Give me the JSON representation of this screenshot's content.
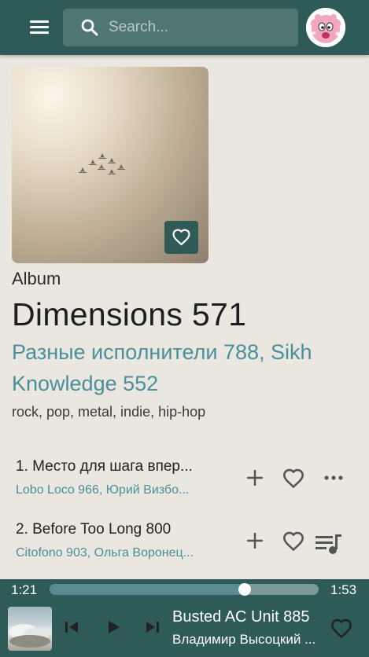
{
  "search": {
    "placeholder": "Search..."
  },
  "album": {
    "type_label": "Album",
    "title": "Dimensions 571",
    "artists": "Разные исполнители 788, Sikh Knowledge 552",
    "genres": "rock, pop, metal, indie, hip-hop"
  },
  "tracks": [
    {
      "title": "1. Место для шага впер...",
      "artists": "Lobo Loco 966, Юрий Визбо..."
    },
    {
      "title": "2. Before Too Long 800",
      "artists": "Citofono 903, Ольга Воронец..."
    }
  ],
  "player": {
    "current_time": "1:21",
    "total_time": "1:53",
    "progress_fraction": 0.725,
    "title": "Busted AC Unit 885",
    "artist": "Владимир Высоцкий ..."
  },
  "icons": {
    "menu": "menu-icon",
    "search": "search-icon",
    "heart": "heart-outline-icon",
    "add": "plus-icon",
    "more": "more-horizontal-icon",
    "queue": "queue-music-icon",
    "previous": "skip-previous-icon",
    "play": "play-icon",
    "next": "skip-next-icon"
  },
  "colors": {
    "accent": "#2e5a57",
    "link": "#4a8f99",
    "background": "#e9e7e0"
  }
}
